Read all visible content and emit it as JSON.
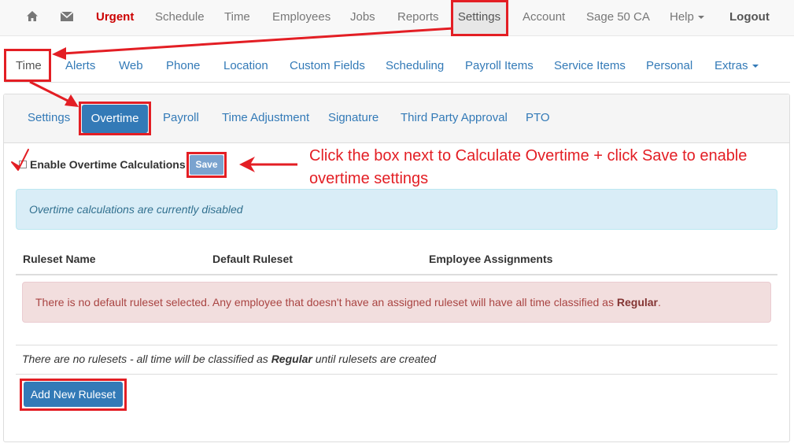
{
  "topnav": {
    "items": [
      {
        "label": ""
      },
      {
        "label": ""
      },
      {
        "label": "Urgent"
      },
      {
        "label": "Schedule"
      },
      {
        "label": "Time"
      },
      {
        "label": "Employees"
      },
      {
        "label": "Jobs"
      },
      {
        "label": "Reports"
      },
      {
        "label": "Settings"
      },
      {
        "label": "Account"
      },
      {
        "label": "Sage 50 CA"
      },
      {
        "label": "Help"
      },
      {
        "label": "Logout"
      }
    ],
    "home_icon": "home-icon",
    "mail_icon": "envelope-icon"
  },
  "subnav": {
    "tabs": [
      {
        "label": "Time"
      },
      {
        "label": "Alerts"
      },
      {
        "label": "Web"
      },
      {
        "label": "Phone"
      },
      {
        "label": "Location"
      },
      {
        "label": "Custom Fields"
      },
      {
        "label": "Scheduling"
      },
      {
        "label": "Payroll Items"
      },
      {
        "label": "Service Items"
      },
      {
        "label": "Personal"
      },
      {
        "label": "Extras"
      }
    ]
  },
  "panel": {
    "tabs": [
      {
        "label": "Settings"
      },
      {
        "label": "Overtime"
      },
      {
        "label": "Payroll"
      },
      {
        "label": "Time Adjustment"
      },
      {
        "label": "Signature"
      },
      {
        "label": "Third Party Approval"
      },
      {
        "label": "PTO"
      }
    ],
    "enable_label": "Enable Overtime Calculations",
    "save_label": "Save",
    "info_text": "Overtime calculations are currently disabled",
    "table": {
      "headers": [
        "Ruleset Name",
        "Default Ruleset",
        "Employee Assignments"
      ]
    },
    "danger_prefix": "There is no default ruleset selected. Any employee that doesn't have an assigned ruleset will have all time classified as ",
    "danger_bold": "Regular",
    "danger_suffix": ".",
    "norules_prefix": "There are no rulesets - all time will be classified as ",
    "norules_bold": "Regular",
    "norules_suffix": " until rulesets are created",
    "add_label": "Add New Ruleset"
  },
  "annotation": {
    "callout": "Click the box next to Calculate Overtime + click Save to enable overtime settings",
    "color": "#e31e24"
  },
  "colors": {
    "link": "#337ab7",
    "urgent": "#cc0000"
  }
}
